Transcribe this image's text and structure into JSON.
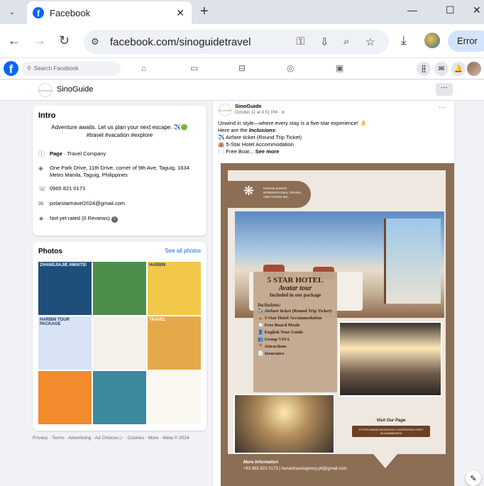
{
  "browser": {
    "tab_title": "Facebook",
    "url": "facebook.com/sinoguidetravel",
    "error_label": "Error"
  },
  "fb": {
    "search_placeholder": "Search Facebook"
  },
  "page": {
    "name": "SinoGuide",
    "logo_text": "SinoGuide"
  },
  "intro": {
    "title": "Intro",
    "bio": "Adventure awaits. Let us plan your next escape. ✈️🟢",
    "hashtags": "#travel #vacation #explore",
    "category_bold": "Page",
    "category": " · Travel Company",
    "address": "One Park Drive, 11th Drive, corner of 9th Ave, Taguig, 1634 Metro Manila, Taguig, Philippines",
    "phone": "0965 821 0173",
    "email": "polarstartravel2024@gmail.com",
    "rating": "Not yet rated (0 Reviews)"
  },
  "photos": {
    "title": "Photos",
    "see_all": "See all photos",
    "items": [
      {
        "label": "ZHANGJIAJIE AWAITS!",
        "color": "#1e4f7a"
      },
      {
        "label": "",
        "color": "#4c8f4a"
      },
      {
        "label": "HARBIN",
        "color": "#f2c84b"
      },
      {
        "label": "HARBIN TOUR PACKAGE",
        "color": "#d8e3f5"
      },
      {
        "label": "",
        "color": "#f4f1ea"
      },
      {
        "label": "TRAVEL",
        "color": "#e6a94a"
      },
      {
        "label": "",
        "color": "#f28a2e"
      },
      {
        "label": "",
        "color": "#3d8a9e"
      },
      {
        "label": "",
        "color": "#faf7f1"
      }
    ]
  },
  "footer": "Privacy · Terms · Advertising · Ad Choices ▷ · Cookies · More · Meta © 2024",
  "post": {
    "author": "SinoGuide",
    "time": "October 11 at 4:51 PM · ",
    "line1": "Unwind in style—where every stay is a five-star experience! 👌",
    "line2_pre": "Here are the ",
    "line2_bold": "Inclusions",
    "line2_post": ":",
    "item1": "✈️ Airfare ticket (Round Trip Ticket)",
    "item2": "🏨 5-Star Hotel Accommodation",
    "item3": "🍽️ Free Boar... ",
    "see_more": "See more"
  },
  "poster": {
    "company": "HUNAN SAMAR INTERNATIONAL TRAVEL AND TOURS INC.",
    "headline1": "5 STAR HOTEL",
    "headline2": "Avatar tour",
    "headline3": "Included in our package",
    "inclusions_title": "Inclusions:",
    "inclusions": [
      "✈️ Airfare ticket (Round Trip Ticket)",
      "🏨 5-Star Hotel Accommodation",
      "🍽️ Free Board Meals",
      "👤 English Tour Guide",
      "👥 Group VISA",
      "📍 Attractions",
      "📄 Insurance"
    ],
    "visit_label": "Visit Our Page",
    "visit_link": "HTTPS://WWW.FACEBOOK.COM/PROFILE.PHP?ID=61566625970",
    "more_info": "More Information",
    "contact": "+63 965 821 0173 | hunantravelagency.ph@gmail.com"
  }
}
